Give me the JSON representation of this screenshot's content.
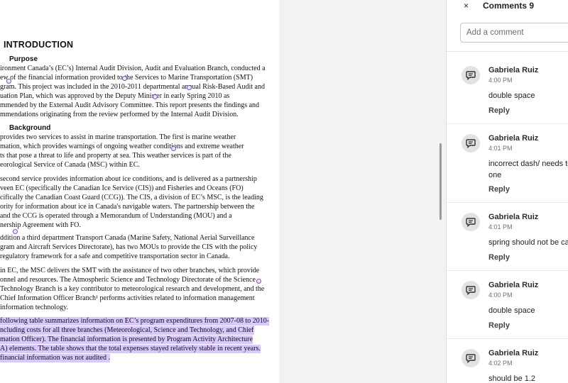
{
  "document": {
    "heading": "INTRODUCTION",
    "sections": [
      {
        "title": "Purpose",
        "paragraphs": [
          [
            "ironment Canada’s (EC’s) Internal Audit Division, Audit and Evaluation Branch, conducted a",
            "ew of the financial information provided to the Services to Marine Transportation (SMT)",
            "gram. This project was included in the 2010-2011 departmental annual Risk-Based Audit and",
            "uation Plan, which was approved by the Deputy Minister in early Spring 2010 as",
            "mmended by the External Audit Advisory Committee. This report presents the findings and",
            "mmendations originating from the review performed by the Internal Audit Division."
          ]
        ]
      },
      {
        "title": "Background",
        "paragraphs": [
          [
            "provides two services to assist in marine transportation. The first is marine weather",
            "mation, which provides warnings of ongoing weather conditions and extreme weather",
            "ts that pose a threat to life and property at sea. This weather services is part of the",
            "eorological Service of Canada (MSC) within EC."
          ],
          [
            "second service provides information about ice conditions, and is delivered as a partnership",
            "veen EC (specifically the Canadian Ice Service (CIS)) and Fisheries and Oceans (FO)",
            "cifically the Canadian Coast Guard (CCG)). The CIS, a division of EC’s MSC, is the leading",
            "ority for information about ice in Canada's navigable waters. The partnership between the",
            "and the CCG is operated through a Memorandum of Understanding (MOU) and a",
            "nership Agreement with FO."
          ],
          [
            "ddition a third department Transport Canada (Marine Safety, National Aerial Surveillance",
            "gram and Aircraft Services Directorate), has two MOUs to provide the CIS with the policy",
            "regulatory framework for a safe and competitive transportation sector in Canada."
          ],
          [
            "in EC, the MSC delivers the SMT with the assistance of two other branches, which provide",
            "onnel and resources. The Atmospheric Science and Technology Directorate of the Science",
            "Technology Branch is a key contributor to meteorological research and development, and the",
            "Chief Information Officer Branch¹ performs activities related to information management",
            "information technology."
          ],
          [
            "following table summarizes information on EC’s program expenditures from 2007-08 to 2010-",
            "ncluding costs for all three branches (Meteorological, Science and Technology, and Chief",
            "mation Officer). The financial information is presented by Program Activity Architecture",
            "A) elements. The table shows that the total expenses stayed relatively stable in recent years.",
            "financial information was not audited ."
          ]
        ]
      }
    ]
  },
  "panel": {
    "close_glyph": "×",
    "title": "Comments 9",
    "add_placeholder": "Add a comment",
    "reply_label": "Reply",
    "comments": [
      {
        "author": "Gabriela Ruiz",
        "time": "4:00 PM",
        "lines": [
          "double space"
        ]
      },
      {
        "author": "Gabriela Ruiz",
        "time": "4:01 PM",
        "lines": [
          "incorrect dash/ needs to",
          "one"
        ]
      },
      {
        "author": "Gabriela Ruiz",
        "time": "4:01 PM",
        "lines": [
          "spring should not be ca"
        ]
      },
      {
        "author": "Gabriela Ruiz",
        "time": "4:00 PM",
        "lines": [
          "double space"
        ]
      },
      {
        "author": "Gabriela Ruiz",
        "time": "4:02 PM",
        "lines": [
          "should be 1.2"
        ]
      }
    ]
  },
  "colors": {
    "highlight": "#d9c7ff",
    "comment_marker": "#7d4fe0",
    "avatar_bg": "#e2e2e2"
  },
  "icons": {
    "close": "close-icon",
    "avatar": "comment-avatar-icon",
    "marker": "comment-marker-icon"
  }
}
